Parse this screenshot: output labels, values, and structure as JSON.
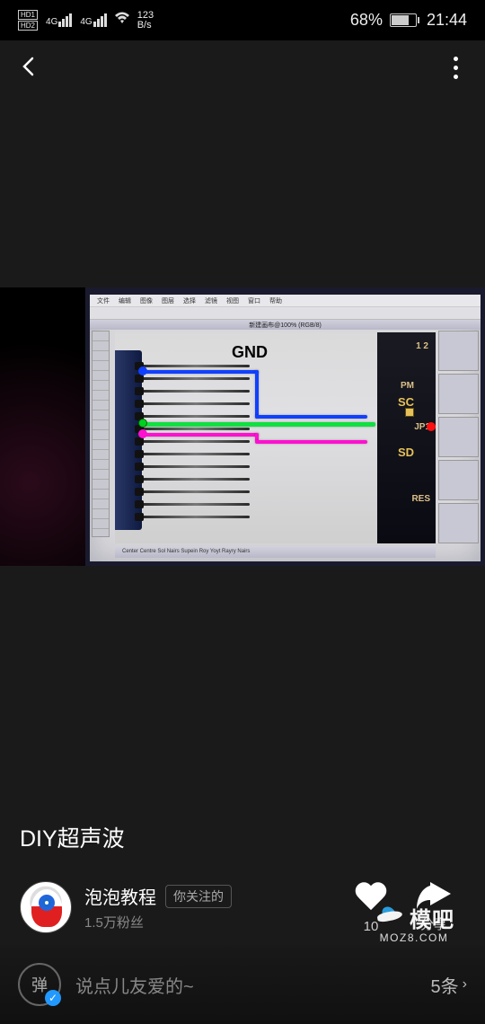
{
  "status": {
    "hd1": "HD1",
    "hd2": "HD2",
    "net1": "4G",
    "net2": "4G",
    "data_rate_line1": "123",
    "data_rate_line2": "B/s",
    "battery_pct": "68%",
    "time": "21:44"
  },
  "video": {
    "title": "DIY超声波",
    "editor": {
      "titlebar": "新建画布@100% (RGB/8)",
      "status_text": "Center Centre Sol Nairs Supein Roy Yoyt Rayry Nairs",
      "menu": [
        "文件",
        "编辑",
        "图像",
        "图层",
        "选择",
        "滤镜",
        "视图",
        "窗口",
        "帮助"
      ],
      "labels": {
        "gnd": "GND",
        "pm": "PM",
        "sc": "SC",
        "jp1": "JP1",
        "sd": "SD",
        "res": "RES",
        "n12": "1 2"
      }
    }
  },
  "author": {
    "name": "泡泡教程",
    "follow_label": "你关注的",
    "fans": "1.5万粉丝"
  },
  "actions": {
    "like_count": "10",
    "share_label": "分享"
  },
  "bottom": {
    "danmu_char": "弹",
    "placeholder": "说点儿友爱的~",
    "comment_count": "5条"
  },
  "watermark": {
    "name": "模吧",
    "url": "MOZ8.COM"
  }
}
